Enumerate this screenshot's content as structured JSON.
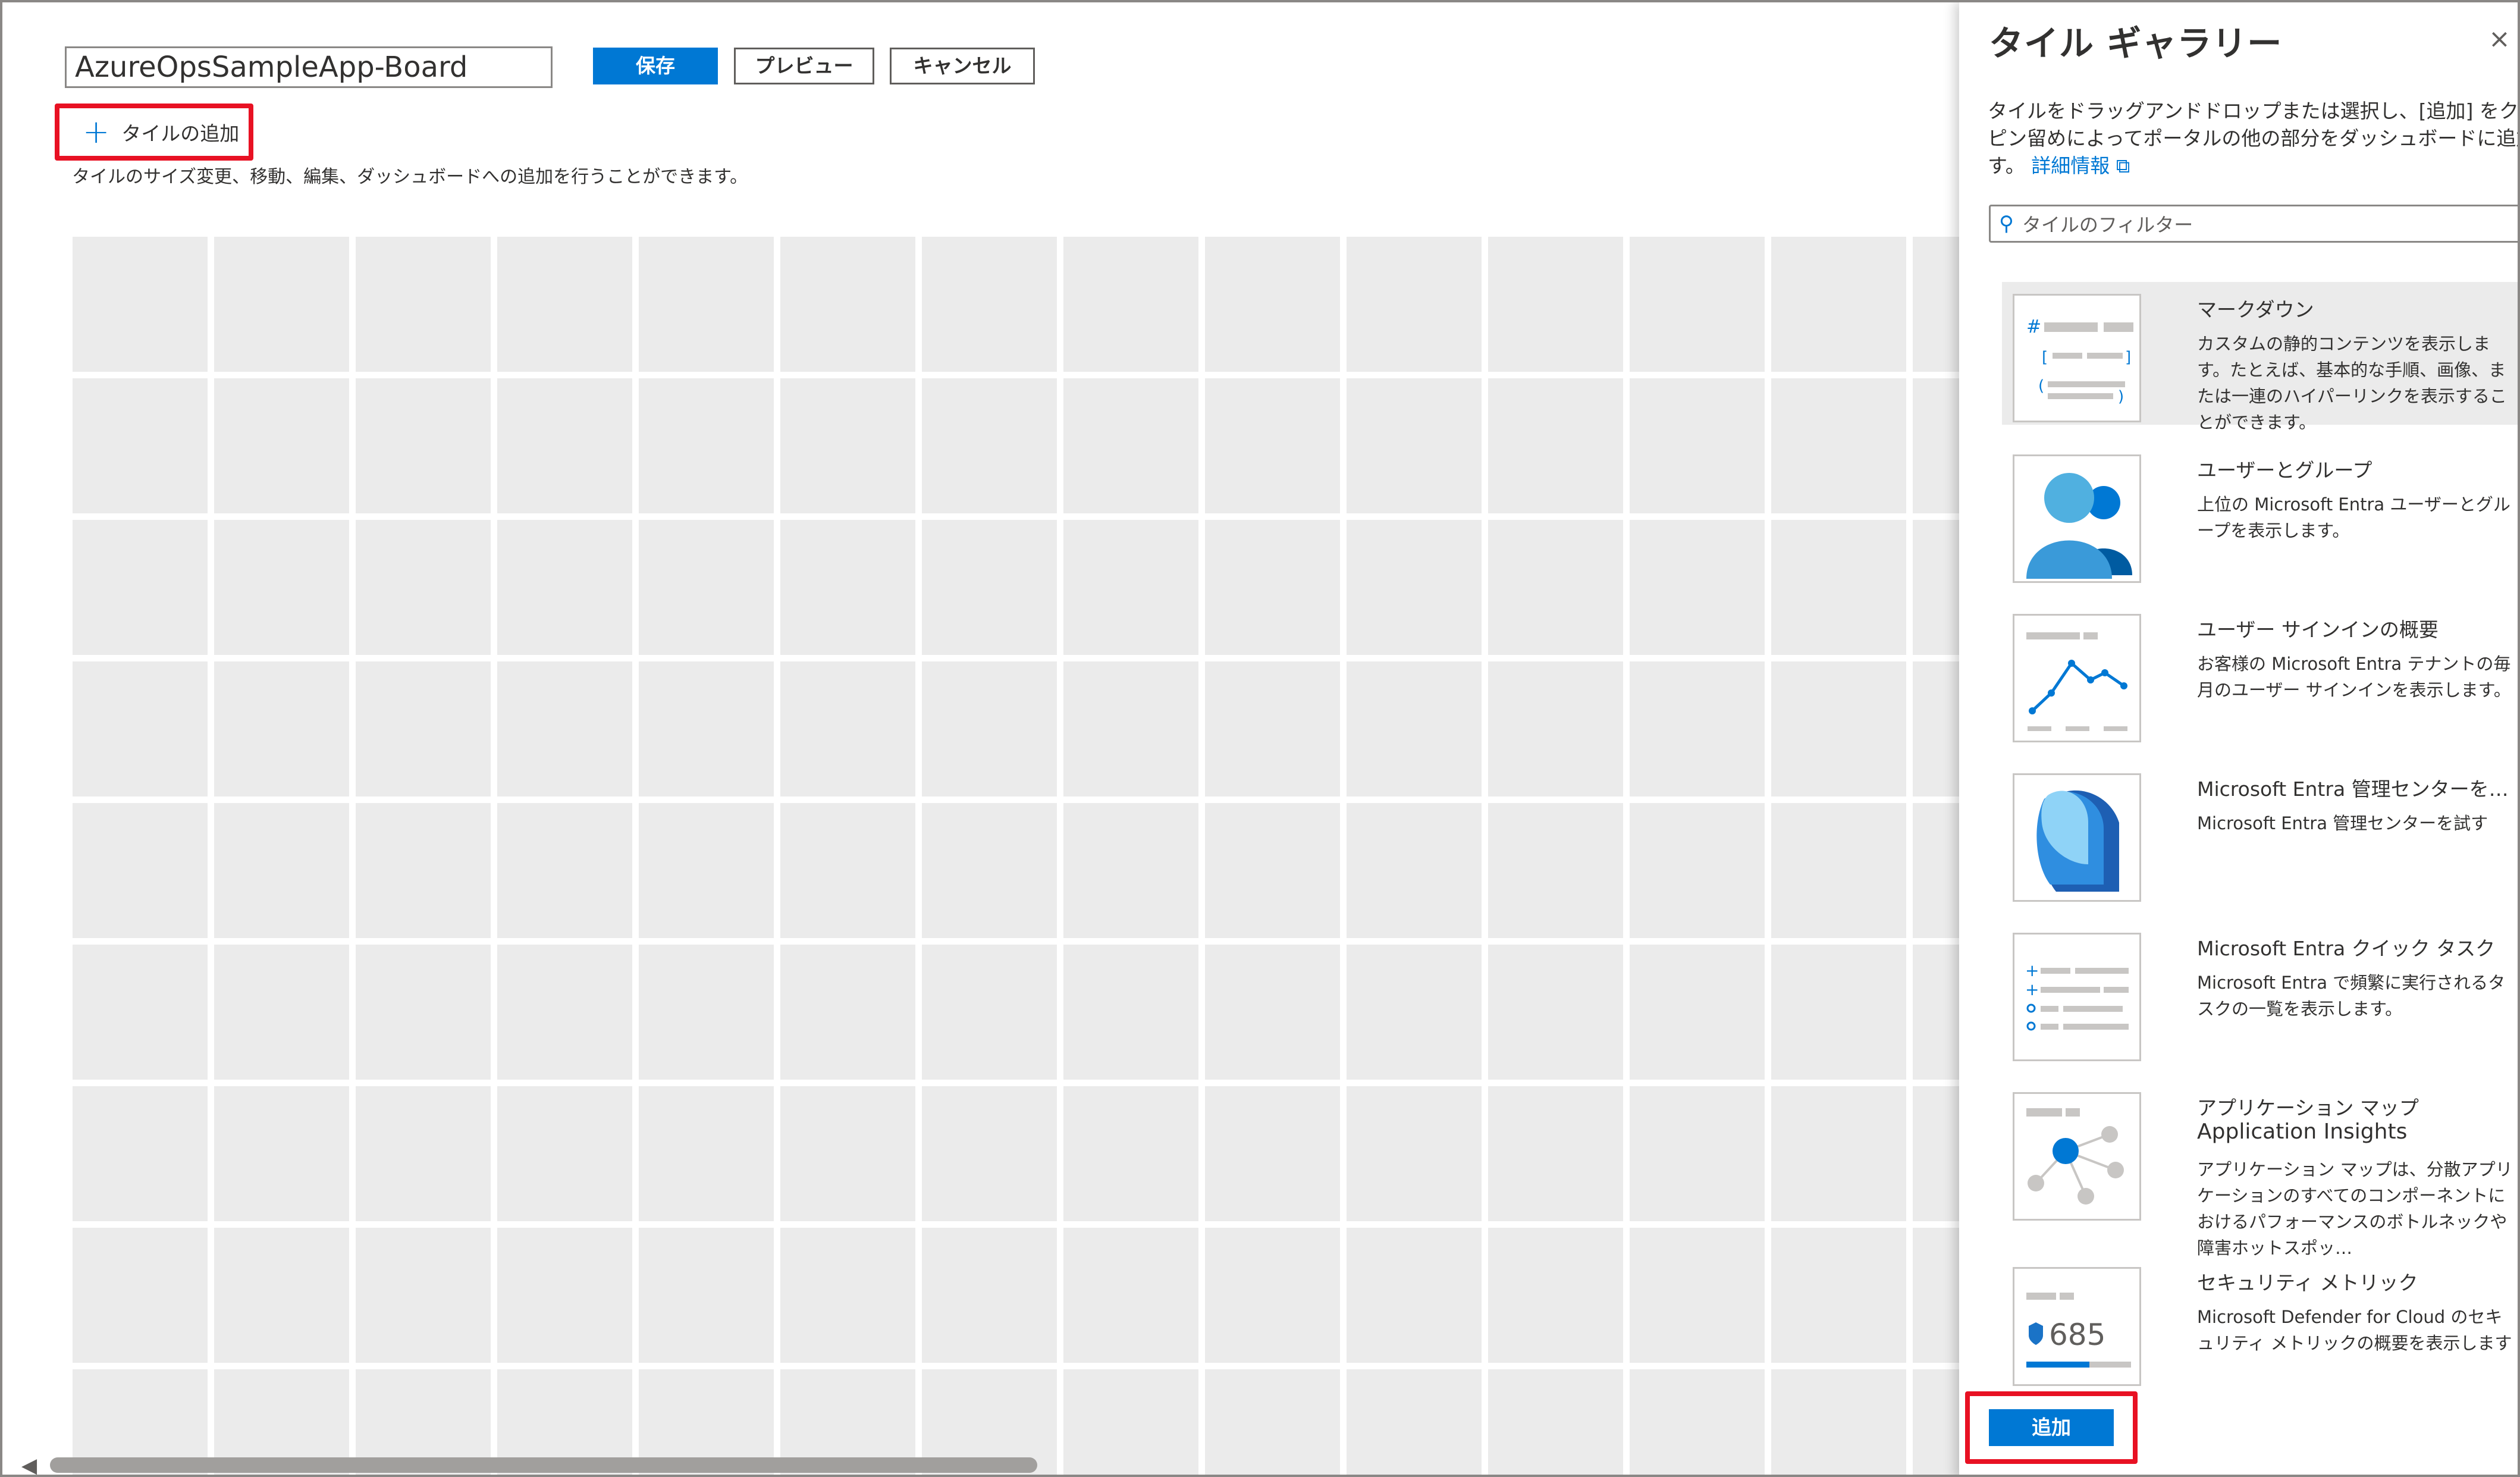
{
  "editor": {
    "dashboard_name": "AzureOpsSampleApp-Board",
    "save_label": "保存",
    "preview_label": "プレビュー",
    "cancel_label": "キャンセル",
    "add_tile_label": "タイルの追加",
    "hint": "タイルのサイズ変更、移動、編集、ダッシュボードへの追加を行うことができます。"
  },
  "gallery": {
    "title": "タイル ギャラリー",
    "close_icon": "close-icon",
    "desc_line1": "タイルをドラッグアンドドロップまたは選択し、[追加] をクリックしま",
    "desc_line2": "ピン留めによってポータルの他の部分をダッシュボードに追加できま",
    "desc_line3": "す。",
    "learn_more": "詳細情報",
    "filter_placeholder": "タイルのフィルター",
    "tiles": [
      {
        "name": "マークダウン",
        "desc": "カスタムの静的コンテンツを表示します。たとえば、基本的な手順、画像、または一連のハイパーリンクを表示することができます。",
        "icon": "markdown-icon"
      },
      {
        "name": "ユーザーとグループ",
        "desc": "上位の Microsoft Entra ユーザーとグループを表示します。",
        "icon": "users-groups-icon"
      },
      {
        "name": "ユーザー サインインの概要",
        "desc": "お客様の Microsoft Entra テナントの毎月のユーザー サインインを表示します。",
        "icon": "line-chart-icon"
      },
      {
        "name": "Microsoft Entra 管理センターを…",
        "desc": "Microsoft Entra 管理センターを試す",
        "icon": "entra-logo-icon"
      },
      {
        "name": "Microsoft Entra クイック タスク",
        "desc": "Microsoft Entra で頻繁に実行されるタスクの一覧を表示します。",
        "icon": "quick-tasks-icon"
      },
      {
        "name": "アプリケーション マップ",
        "name2": "Application Insights",
        "desc": "アプリケーション マップは、分散アプリケーションのすべてのコンポーネントにおけるパフォーマンスのボトルネックや障害ホットスポッ…",
        "icon": "app-map-icon"
      },
      {
        "name": "セキュリティ メトリック",
        "desc": "Microsoft Defender for Cloud のセキュリティ メトリックの概要を表示します",
        "icon": "security-metric-icon",
        "metric": "685"
      }
    ],
    "add_label": "追加"
  },
  "colors": {
    "accent": "#0078d4",
    "highlight": "#e81123",
    "tile_bg": "#ebebeb"
  }
}
